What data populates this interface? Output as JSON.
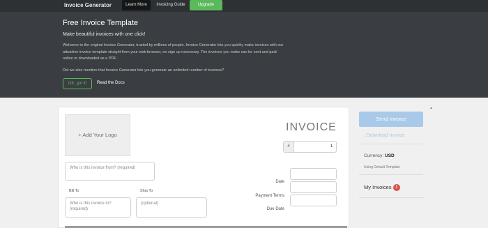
{
  "nav": {
    "brand": "Invoice Generator",
    "learn_more": "Learn More",
    "guide": "Invoicing Guide",
    "upgrade": "Upgrade"
  },
  "hero": {
    "title": "Free Invoice Template",
    "subtitle": "Make beautiful invoices with one click!",
    "description": "Welcome to the original Invoice Generator, trusted by millions of people. Invoice Generator lets you quickly make invoices with our attractive invoice template straight from your web browser, no sign up necessary. The invoices you make can be sent and paid online or downloaded as a PDF.",
    "question": "Did we also mention that Invoice Generator lets you generate an unlimited number of invoices?",
    "ok_button": "OK, got it!",
    "docs_link": "Read the Docs"
  },
  "invoice": {
    "logo_label": "+ Add Your Logo",
    "from_placeholder": "Who is this invoice from? (required)",
    "bill_to_label": "Bill To",
    "ship_to_label": "Ship To",
    "bill_to_placeholder": "Who is this invoice to? (required)",
    "ship_to_placeholder": "(optional)",
    "title": "INVOICE",
    "number_prefix": "#",
    "number_value": "1",
    "date_label": "Date",
    "payment_terms_label": "Payment Terms",
    "due_date_label": "Due Date"
  },
  "sidebar": {
    "send_button": "Send Invoice",
    "download_link": "Download Invoice",
    "download_icon": "↓",
    "currency_label": "Currency:",
    "currency_value": "USD",
    "template_text": "Using Default Template",
    "my_invoices": "My Invoices",
    "my_invoices_count": "1"
  },
  "colors": {
    "nav_bg": "#2e3134",
    "hero_bg": "#3a3e42",
    "accent_green": "#5cb85c",
    "send_blue": "#a9c9e8",
    "badge_red": "#d9534f"
  }
}
